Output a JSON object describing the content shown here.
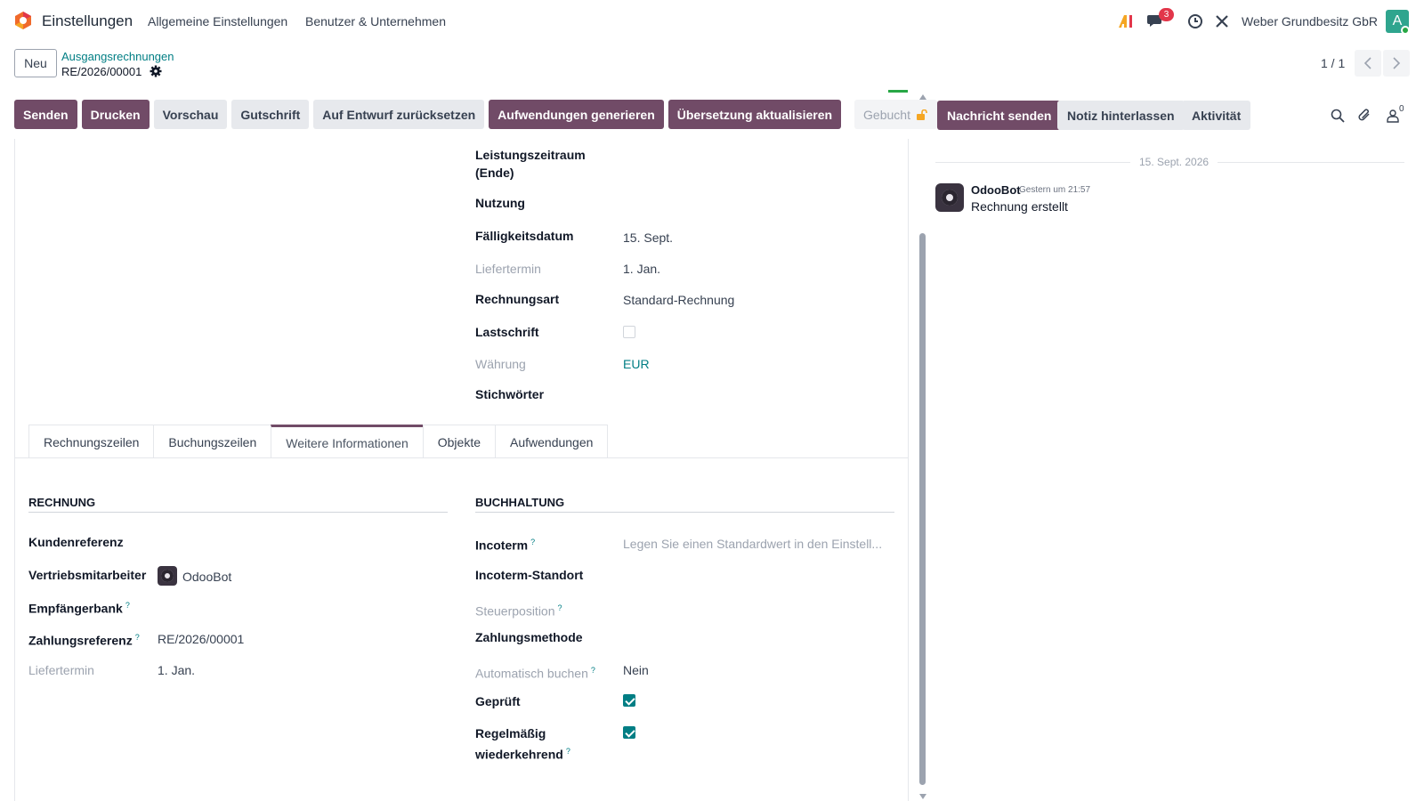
{
  "nav": {
    "app_title": "Einstellungen",
    "menu": [
      "Allgemeine Einstellungen",
      "Benutzer & Unternehmen"
    ],
    "messages_badge": "3",
    "company": "Weber Grundbesitz GbR",
    "avatar_letter": "A"
  },
  "control": {
    "new_label": "Neu",
    "breadcrumb_parent": "Ausgangsrechnungen",
    "breadcrumb_current": "RE/2026/00001",
    "pager": "1 / 1"
  },
  "statusbar": {
    "buttons": [
      "Senden",
      "Drucken",
      "Vorschau",
      "Gutschrift",
      "Auf Entwurf zurücksetzen",
      "Aufwendungen generieren",
      "Übersetzung aktualisieren"
    ],
    "state": "Gebucht"
  },
  "header_fields": {
    "leistungszeitraum_label": "Leistungszeitraum (Ende)",
    "nutzung_label": "Nutzung",
    "faelligkeitsdatum_label": "Fälligkeitsdatum",
    "faelligkeitsdatum_value": "15. Sept.",
    "liefertermin_label": "Liefertermin",
    "liefertermin_value": "1. Jan.",
    "rechnungsart_label": "Rechnungsart",
    "rechnungsart_value": "Standard-Rechnung",
    "lastschrift_label": "Lastschrift",
    "waehrung_label": "Währung",
    "waehrung_value": "EUR",
    "stichwoerter_label": "Stichwörter"
  },
  "tabs": [
    "Rechnungszeilen",
    "Buchungszeilen",
    "Weitere Informationen",
    "Objekte",
    "Aufwendungen"
  ],
  "rechnung": {
    "title": "RECHNUNG",
    "kundenreferenz_label": "Kundenreferenz",
    "vertrieb_label": "Vertriebsmitarbeiter",
    "vertrieb_value": "OdooBot",
    "empfaengerbank_label": "Empfängerbank",
    "zahlungsreferenz_label": "Zahlungsreferenz",
    "zahlungsreferenz_value": "RE/2026/00001",
    "liefertermin_label": "Liefertermin",
    "liefertermin_value": "1. Jan."
  },
  "buchhaltung": {
    "title": "BUCHHALTUNG",
    "incoterm_label": "Incoterm",
    "incoterm_placeholder": "Legen Sie einen Standardwert in den Einstell...",
    "incoterm_standort_label": "Incoterm-Standort",
    "steuerposition_label": "Steuerposition",
    "zahlungsmethode_label": "Zahlungsmethode",
    "automatisch_label": "Automatisch buchen",
    "automatisch_value": "Nein",
    "geprueft_label": "Geprüft",
    "regelmaessig_label": "Regelmäßig wiederkehrend"
  },
  "chatter": {
    "send_message": "Nachricht senden",
    "log_note": "Notiz hinterlassen",
    "activity": "Aktivität",
    "followers_count": "0",
    "date_separator": "15. Sept. 2026",
    "message_author": "OdooBot",
    "message_time": "Gestern um 21:57",
    "message_body": "Rechnung erstellt"
  },
  "colors": {
    "primary": "#714b67",
    "link": "#017e84",
    "badge": "#e2364a"
  }
}
